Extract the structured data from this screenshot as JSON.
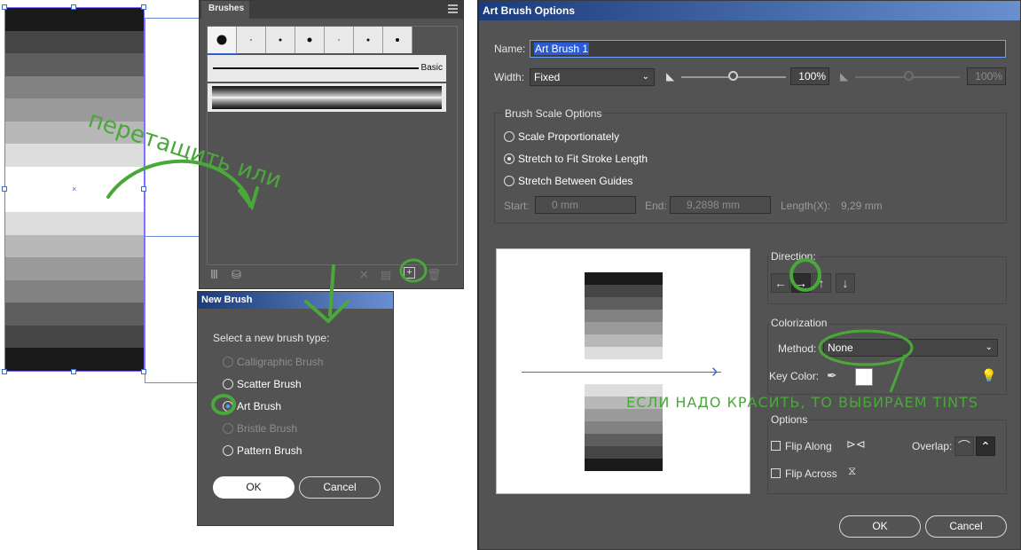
{
  "canvas": {
    "stripes": [
      "#1a1a1a",
      "#454545",
      "#5e5e5e",
      "#828282",
      "#9a9a9a",
      "#b8b8b8",
      "#dddddd",
      "#ffffff",
      "#ffffff",
      "#dddddd",
      "#b8b8b8",
      "#9a9a9a",
      "#828282",
      "#5e5e5e",
      "#454545",
      "#1a1a1a"
    ]
  },
  "brushes_panel": {
    "tab_label": "Brushes",
    "basic_label": "Basic",
    "footer_icons": [
      "brush-libraries-icon",
      "libraries-panel-icon",
      "remove-stroke-icon",
      "brush-options-icon",
      "new-brush-icon",
      "delete-brush-icon"
    ]
  },
  "new_brush": {
    "title": "New Brush",
    "prompt": "Select a new brush type:",
    "options": [
      {
        "label": "Calligraphic Brush",
        "enabled": false,
        "selected": false
      },
      {
        "label": "Scatter Brush",
        "enabled": true,
        "selected": false
      },
      {
        "label": "Art Brush",
        "enabled": true,
        "selected": true
      },
      {
        "label": "Bristle Brush",
        "enabled": false,
        "selected": false
      },
      {
        "label": "Pattern Brush",
        "enabled": true,
        "selected": false
      }
    ],
    "ok_label": "OK",
    "cancel_label": "Cancel"
  },
  "art_brush": {
    "title": "Art Brush Options",
    "name_label": "Name:",
    "name_value": "Art Brush 1",
    "width_label": "Width:",
    "width_value": "Fixed",
    "width_percent": "100%",
    "width_percent_max": "100%",
    "scale_group_label": "Brush Scale Options",
    "scale_options": [
      {
        "label": "Scale Proportionately",
        "selected": false
      },
      {
        "label": "Stretch to Fit Stroke Length",
        "selected": true
      },
      {
        "label": "Stretch Between Guides",
        "selected": false
      }
    ],
    "start_label": "Start:",
    "start_value": "0 mm",
    "end_label": "End:",
    "end_value": "9,2898 mm",
    "length_label": "Length(X):",
    "length_value": "9,29 mm",
    "direction_label": "Direction:",
    "colorization_label": "Colorization",
    "method_label": "Method:",
    "method_value": "None",
    "key_color_label": "Key Color:",
    "options_label": "Options",
    "flip_along_label": "Flip Along",
    "flip_across_label": "Flip Across",
    "overlap_label": "Overlap:",
    "ok_label": "OK",
    "cancel_label": "Cancel"
  },
  "annotations": {
    "drag_text": "перетащить или",
    "tints_note": "ЕСЛИ НАДО КРАСИТЬ, ТО ВЫБИРАЕМ TINTS"
  },
  "colors": {
    "annotation_green": "#4aa83a",
    "panel_bg": "#535353",
    "title_blue": "#1b3c7a",
    "arrow_blue": "#3a6cd8"
  }
}
